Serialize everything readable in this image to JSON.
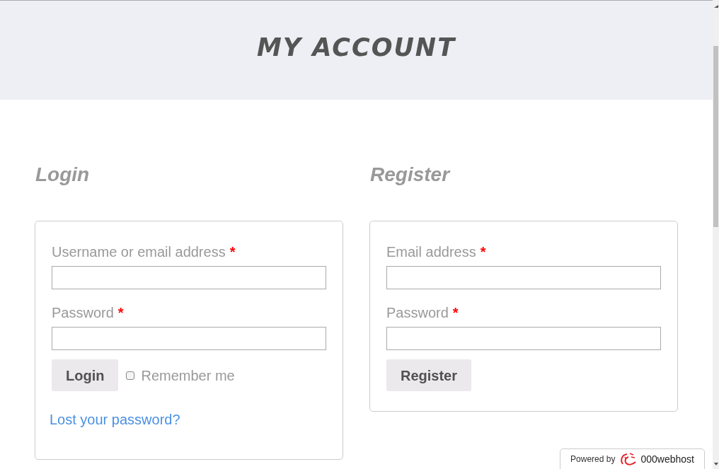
{
  "header": {
    "title": "MY ACCOUNT"
  },
  "login": {
    "heading": "Login",
    "fields": [
      {
        "label": "Username or email address",
        "required_mark": "*"
      },
      {
        "label": "Password",
        "required_mark": "*"
      }
    ],
    "button": "Login",
    "remember": {
      "label": "Remember me",
      "checked": false
    },
    "lost_password_link": "Lost your password?"
  },
  "register": {
    "heading": "Register",
    "fields": [
      {
        "label": "Email address",
        "required_mark": "*"
      },
      {
        "label": "Password",
        "required_mark": "*"
      }
    ],
    "button": "Register"
  },
  "badge": {
    "prefix": "Powered by",
    "brand": "000webhost"
  }
}
